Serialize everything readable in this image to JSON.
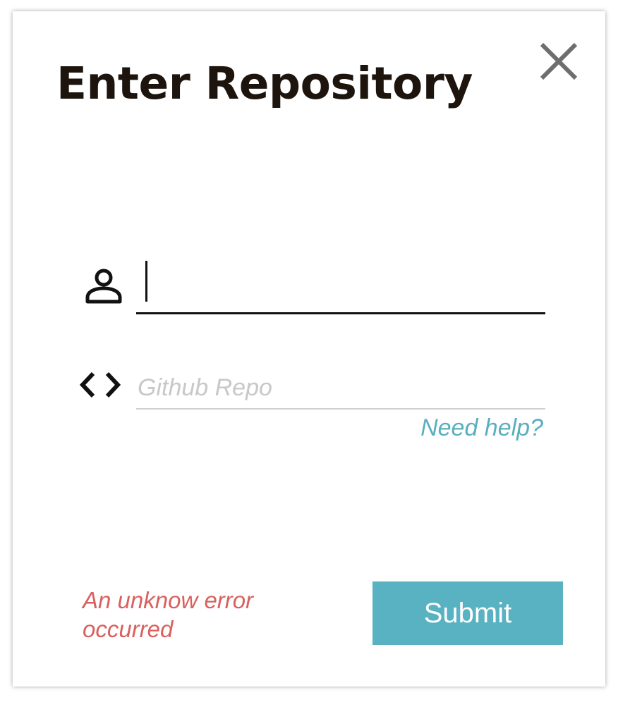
{
  "dialog": {
    "title": "Enter Repository",
    "close_icon": "close-icon"
  },
  "form": {
    "user_field": {
      "icon": "user-icon",
      "value": "",
      "placeholder": ""
    },
    "repo_field": {
      "icon": "code-icon",
      "value": "",
      "placeholder": "Github Repo"
    },
    "help_link": "Need help?",
    "error_message": "An unknow error occurred",
    "submit_label": "Submit"
  },
  "colors": {
    "accent": "#58b2c1",
    "link": "#5aafbe",
    "error": "#d9605e",
    "title": "#1c140d"
  }
}
